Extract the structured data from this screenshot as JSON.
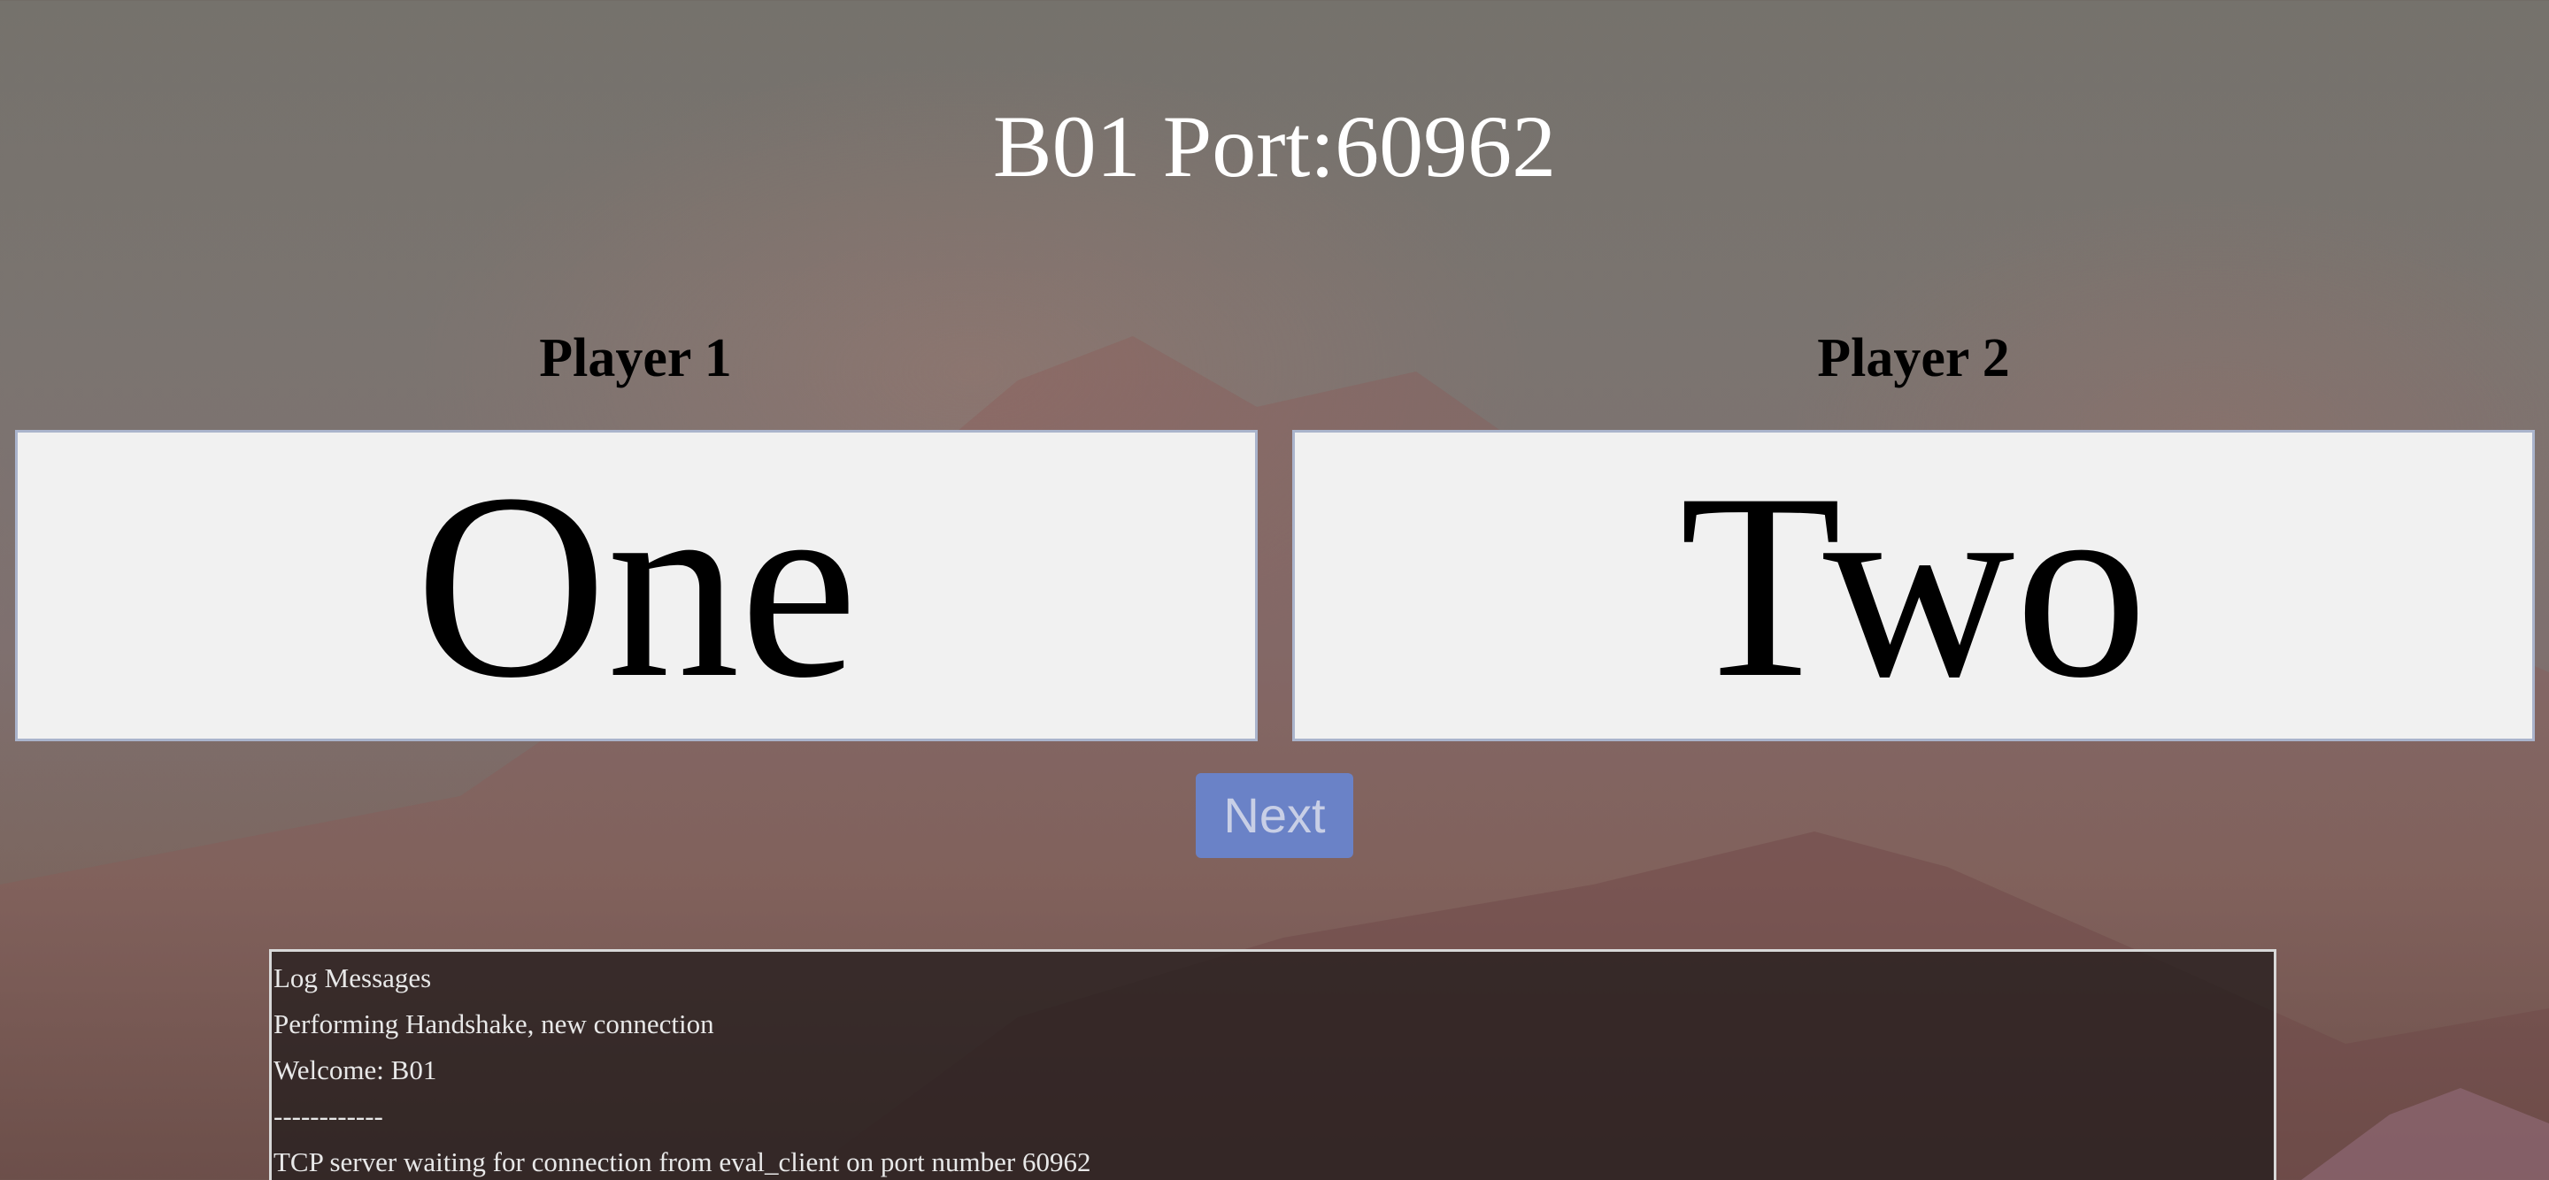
{
  "header": {
    "title": "B01 Port:60962"
  },
  "players": [
    {
      "label": "Player 1",
      "value": "One"
    },
    {
      "label": "Player 2",
      "value": "Two"
    }
  ],
  "controls": {
    "next_label": "Next"
  },
  "log": {
    "lines": [
      "Log Messages",
      "Performing Handshake, new connection",
      "Welcome: B01",
      "------------",
      "TCP server waiting for connection from eval_client on port number 60962"
    ]
  },
  "colors": {
    "next_button": "#6a82c7",
    "player_box": "#f1f1f1",
    "player_box_border": "#aab4cc",
    "log_panel": "#2a2222"
  }
}
